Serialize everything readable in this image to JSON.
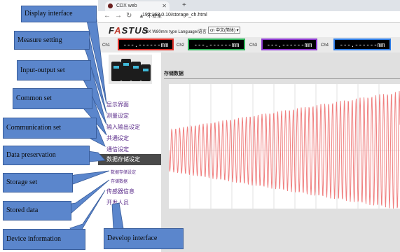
{
  "browser": {
    "tab_title": "CDX web",
    "new_tab": "+",
    "security": "不安全",
    "url": "192.168.0.10/storage_ch.html"
  },
  "app": {
    "logo": "FASTUS",
    "type_label": "CDX W80mm type  Language/语言 :",
    "language_selected": "cn 中文(简体) ▾"
  },
  "channels": [
    {
      "label": "Ch1",
      "value": "---.------mm",
      "color": "#e0322a"
    },
    {
      "label": "Ch2",
      "value": "---.------mm",
      "color": "#2fb35a"
    },
    {
      "label": "Ch3",
      "value": "---.------mm",
      "color": "#8d3ad0"
    },
    {
      "label": "Ch4",
      "value": "---.------mm",
      "color": "#2f7ee8"
    }
  ],
  "menu": {
    "items": [
      "显示界面",
      "测量设定",
      "输入输出设定",
      "共通设定",
      "通信设定"
    ],
    "active": "数据存储设定",
    "sub_items": [
      "数据存储设定",
      "存储数据"
    ],
    "more_items": [
      "传感器信息",
      "开发人员"
    ]
  },
  "content": {
    "title": "存储数据"
  },
  "callouts": [
    "Display interface",
    "Measure setting",
    "Input-output set",
    "Common set",
    "Communication set",
    "Data preservation",
    "Storage set",
    "Stored data",
    "Device information",
    "Develop interface"
  ],
  "colors": {
    "callout_fill": "#5b86cc",
    "waveform": "#f08080"
  },
  "icons": [
    "back-arrow-icon",
    "forward-arrow-icon",
    "reload-icon",
    "warning-icon"
  ]
}
